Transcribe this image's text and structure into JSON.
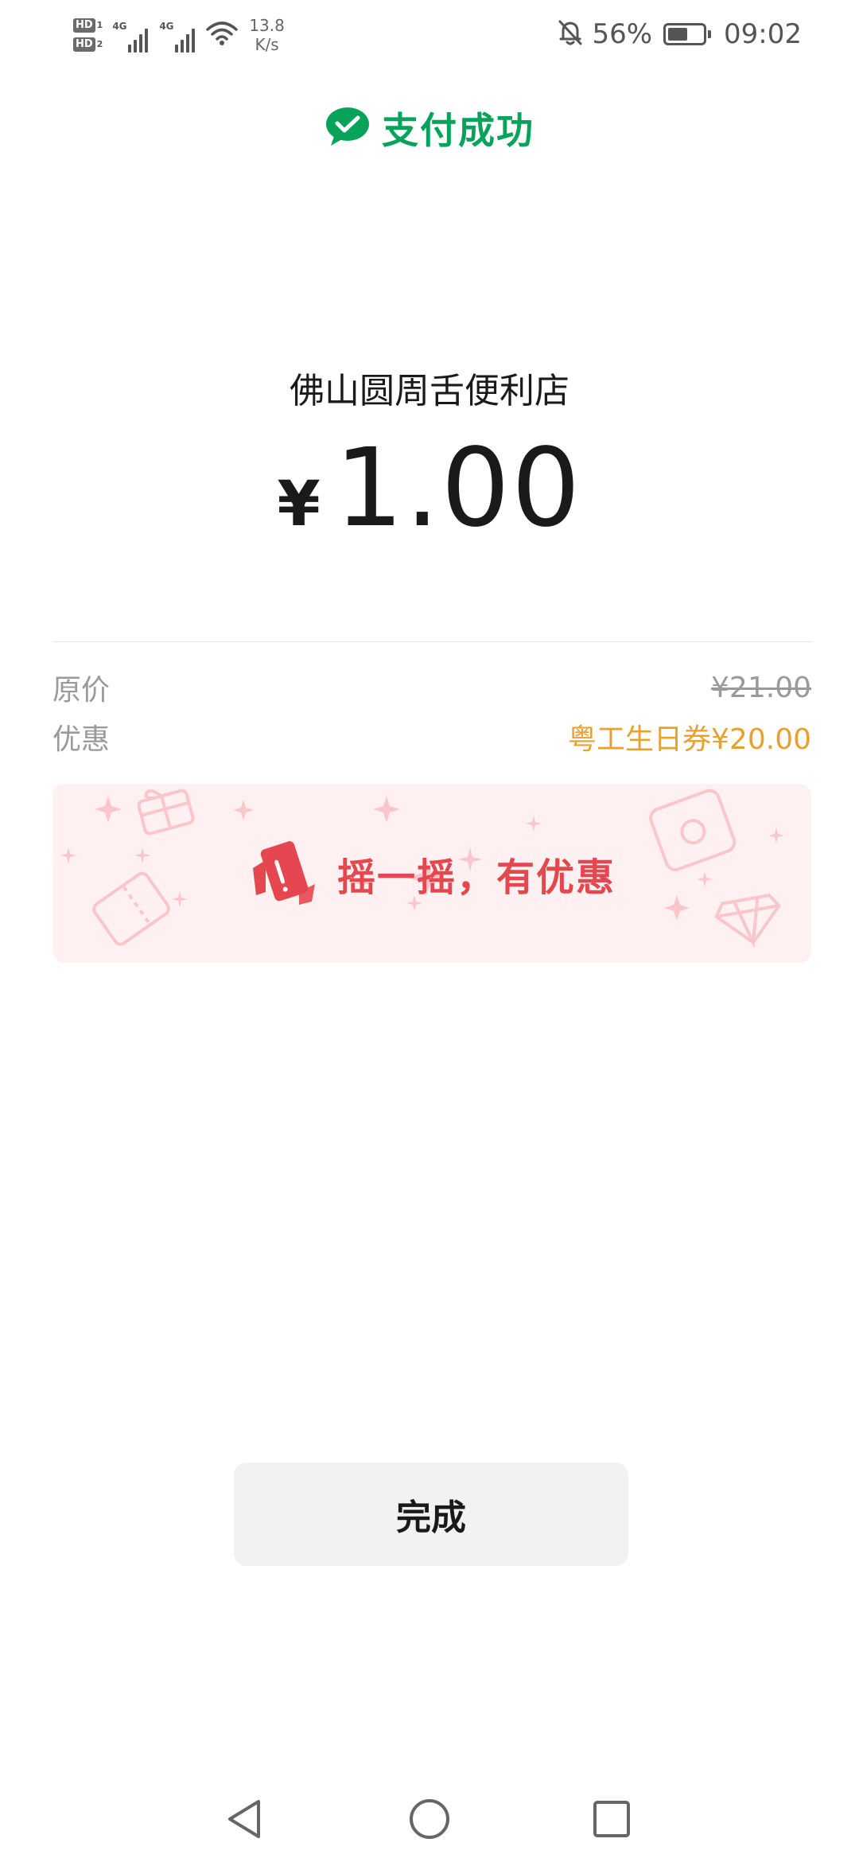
{
  "status_bar": {
    "hd1": "HD",
    "hd1_num": "1",
    "hd2": "HD",
    "hd2_num": "2",
    "net1": "4G",
    "net2": "4G",
    "speed_value": "13.8",
    "speed_unit": "K/s",
    "battery_percent": "56%",
    "battery_level": 0.56,
    "time": "09:02"
  },
  "header": {
    "title": "支付成功",
    "brand_color": "#07a35a"
  },
  "payment": {
    "merchant": "佛山圆周舌便利店",
    "currency": "¥",
    "amount": "1.00"
  },
  "details": {
    "original_label": "原价",
    "original_value": "¥21.00",
    "discount_label": "优惠",
    "discount_value": "粤工生日券¥20.00",
    "discount_color": "#e8a130"
  },
  "banner": {
    "text": "摇一摇，有优惠",
    "text_color": "#e4474f",
    "background": "#fff1f2"
  },
  "actions": {
    "done_label": "完成"
  },
  "nav": {
    "back_icon": "triangle-back-icon",
    "home_icon": "circle-home-icon",
    "recents_icon": "square-recents-icon"
  }
}
